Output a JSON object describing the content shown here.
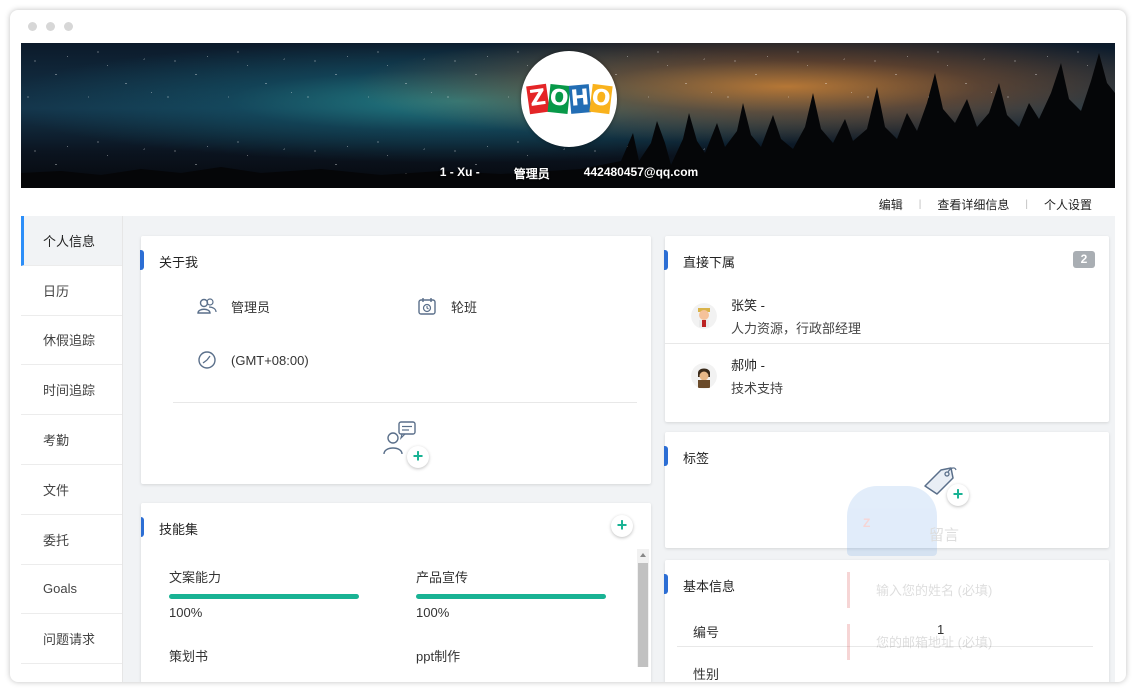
{
  "banner": {
    "logo_letters": [
      "Z",
      "O",
      "H",
      "O"
    ],
    "logo_colors": [
      "#e42527",
      "#089949",
      "#226db4",
      "#f9b21d"
    ],
    "user_name": "1 - Xu -",
    "role": "管理员",
    "email": "442480457@qq.com"
  },
  "actions": {
    "edit": "编辑",
    "view_details": "查看详细信息",
    "personal_settings": "个人设置"
  },
  "sidebar": {
    "items": [
      {
        "label": "个人信息",
        "active": true
      },
      {
        "label": "日历"
      },
      {
        "label": "休假追踪"
      },
      {
        "label": "时间追踪"
      },
      {
        "label": "考勤"
      },
      {
        "label": "文件"
      },
      {
        "label": "委托"
      },
      {
        "label": "Goals"
      },
      {
        "label": "问题请求"
      }
    ]
  },
  "about": {
    "title": "关于我",
    "role_label": "管理员",
    "shift_label": "轮班",
    "timezone": "(GMT+08:00)"
  },
  "skills": {
    "title": "技能集",
    "items": [
      {
        "name": "文案能力",
        "percent": "100%",
        "level": 1.0
      },
      {
        "name": "产品宣传",
        "percent": "100%",
        "level": 1.0
      },
      {
        "name": "策划书"
      },
      {
        "name": "ppt制作"
      }
    ]
  },
  "reports": {
    "title": "直接下属",
    "count": "2",
    "items": [
      {
        "name": "张笑 -",
        "role": "人力资源，行政部经理"
      },
      {
        "name": "郝帅 -",
        "role": "技术支持"
      }
    ]
  },
  "tags": {
    "title": "标签"
  },
  "basic_info": {
    "title": "基本信息",
    "rows": [
      {
        "label": "编号",
        "value": "1"
      },
      {
        "label": "性别",
        "value": ""
      }
    ]
  },
  "overlay": {
    "title": "留言",
    "name_placeholder": "输入您的姓名 (必填)",
    "email_placeholder": "您的邮箱地址 (必填)"
  },
  "colors": {
    "accent_blue": "#2c6ed4",
    "skill_green": "#19b394",
    "active_border": "#2c8ef8"
  }
}
